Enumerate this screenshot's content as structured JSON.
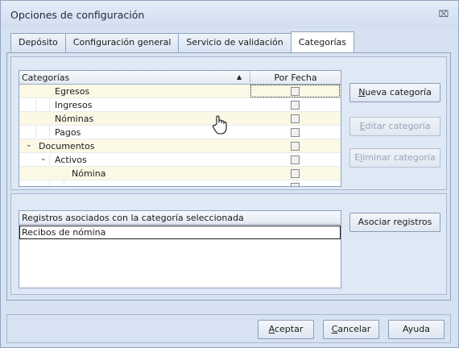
{
  "window": {
    "title": "Opciones de configuración",
    "close_glyph": "⌧"
  },
  "tabs": [
    {
      "label": "Depósito",
      "active": false
    },
    {
      "label": "Configuración general",
      "active": false
    },
    {
      "label": "Servicio de validación",
      "active": false
    },
    {
      "label": "Categorías",
      "active": true
    }
  ],
  "categories_grid": {
    "columns": {
      "category": "Categorías",
      "by_date": "Por Fecha"
    },
    "sort": "ascending",
    "rows": [
      {
        "label": "Egresos",
        "level": 2,
        "checked": false
      },
      {
        "label": "Ingresos",
        "level": 2,
        "checked": false
      },
      {
        "label": "Nóminas",
        "level": 2,
        "checked": false
      },
      {
        "label": "Pagos",
        "level": 2,
        "checked": false
      },
      {
        "label": "Documentos",
        "level": 0,
        "expanded": true,
        "checked": false
      },
      {
        "label": "Activos",
        "level": 1,
        "expanded": true,
        "checked": false
      },
      {
        "label": "Nómina",
        "level": 2,
        "checked": false
      }
    ]
  },
  "category_buttons": {
    "new": {
      "prefix": "",
      "accel": "N",
      "rest": "ueva categoría",
      "enabled": true
    },
    "edit": {
      "prefix": "",
      "accel": "E",
      "rest": "ditar categoría",
      "enabled": false
    },
    "delete": {
      "prefix": "E",
      "accel": "l",
      "rest": "iminar categoría",
      "enabled": false
    }
  },
  "records": {
    "header": "Registros asociados con la categoría seleccionada",
    "rows": [
      "Recibos de nómina"
    ],
    "associate_button": "Asociar registros"
  },
  "footer_buttons": {
    "accept": {
      "accel": "A",
      "rest": "ceptar"
    },
    "cancel": {
      "accel": "C",
      "rest": "ancelar"
    },
    "help": {
      "accel": "",
      "rest": "Ayuda"
    }
  },
  "colors": {
    "window_bg": "#d6e2f1",
    "alt_row": "#fbf8e6",
    "border": "#8ea3bf"
  }
}
